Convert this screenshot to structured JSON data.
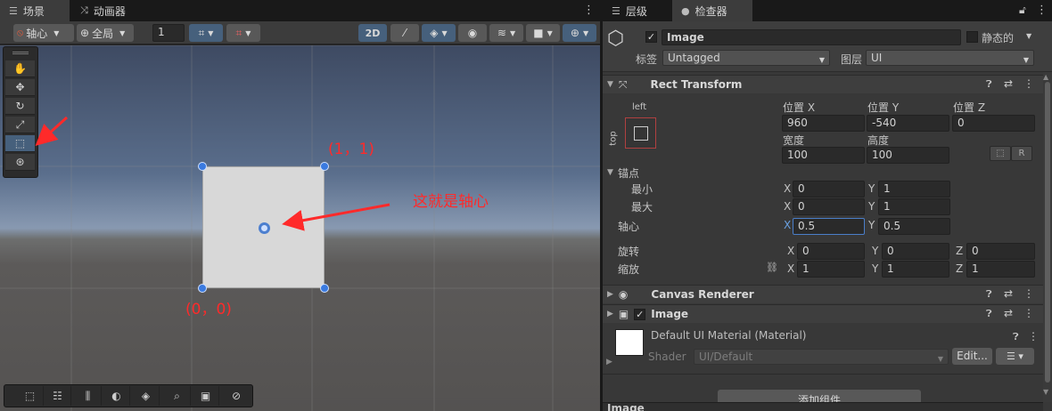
{
  "scene_tabs": {
    "scene": "场景",
    "animator": "动画器"
  },
  "right_tabs": {
    "hierarchy": "层级",
    "inspector": "检查器"
  },
  "scene_toolbar": {
    "pivot": "轴心",
    "global": "全局",
    "snap_value": "1",
    "mode_2d": "2D"
  },
  "annotations": {
    "top_right": "(1，1)",
    "bottom_left": "(0，0)",
    "pivot_note": "这就是轴心"
  },
  "object": {
    "name": "Image",
    "static_label": "静态的",
    "tag_label": "标签",
    "tag_value": "Untagged",
    "layer_label": "图层",
    "layer_value": "UI"
  },
  "rect_transform": {
    "title": "Rect Transform",
    "anchor_left": "left",
    "anchor_top": "top",
    "pos_x_label": "位置 X",
    "pos_y_label": "位置 Y",
    "pos_z_label": "位置 Z",
    "pos_x": "960",
    "pos_y": "-540",
    "pos_z": "0",
    "width_label": "宽度",
    "height_label": "高度",
    "width": "100",
    "height": "100",
    "r_button": "R",
    "anchors_label": "锚点",
    "min_label": "最小",
    "max_label": "最大",
    "min_x": "0",
    "min_y": "1",
    "max_x": "0",
    "max_y": "1",
    "pivot_label": "轴心",
    "pivot_x": "0.5",
    "pivot_y": "0.5",
    "rotation_label": "旋转",
    "rot_x": "0",
    "rot_y": "0",
    "rot_z": "0",
    "scale_label": "缩放",
    "scale_x": "1",
    "scale_y": "1",
    "scale_z": "1",
    "x": "X",
    "y": "Y",
    "z": "Z"
  },
  "canvas_renderer": {
    "title": "Canvas Renderer"
  },
  "image_component": {
    "title": "Image"
  },
  "material": {
    "name": "Default UI Material (Material)",
    "shader_label": "Shader",
    "shader_value": "UI/Default",
    "edit_button": "Edit..."
  },
  "add_component": "添加组件",
  "footer_label": "Image",
  "colors": {
    "accent_blue": "#4a7ec9",
    "annotation_red": "#ff2a2a",
    "panel_bg": "#383838"
  }
}
